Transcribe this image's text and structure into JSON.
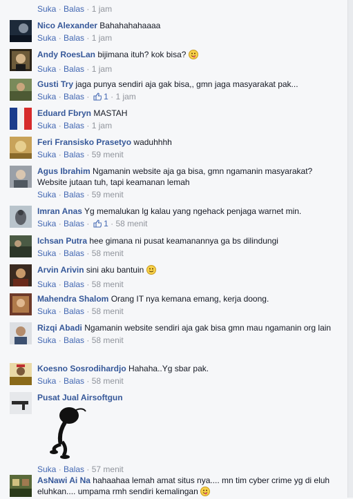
{
  "top_actions": {
    "like": "Suka",
    "reply": "Balas",
    "time": "1 jam"
  },
  "comments": [
    {
      "name": "Nico Alexander",
      "text": "Bahahahahaaaa",
      "like": "Suka",
      "reply": "Balas",
      "likes": "",
      "time": "1 jam"
    },
    {
      "name": "Andy RoesLan",
      "text": "bijimana ituh? kok bisa?",
      "like": "Suka",
      "reply": "Balas",
      "likes": "",
      "time": "1 jam"
    },
    {
      "name": "Gusti Try",
      "text": "jaga punya sendiri aja gak bisa,, gmn jaga masyarakat pak...",
      "like": "Suka",
      "reply": "Balas",
      "likes": "1",
      "time": "1 jam"
    },
    {
      "name": "Eduard Fbryn",
      "text": "MASTAH",
      "like": "Suka",
      "reply": "Balas",
      "likes": "",
      "time": "1 jam"
    },
    {
      "name": "Feri Fransisko Prasetyo",
      "text": "waduhhhh",
      "like": "Suka",
      "reply": "Balas",
      "likes": "",
      "time": "59 menit"
    },
    {
      "name": "Agus Ibrahim",
      "text": "Ngamanin website aja ga bisa, gmn ngamanin masyarakat? Website jutaan tuh, tapi keamanan lemah",
      "like": "Suka",
      "reply": "Balas",
      "likes": "",
      "time": "59 menit"
    },
    {
      "name": "Imran Anas",
      "text": "Yg memalukan lg kalau yang ngehack penjaga warnet min.",
      "like": "Suka",
      "reply": "Balas",
      "likes": "1",
      "time": "58 menit"
    },
    {
      "name": "Ichsan Putra",
      "text": "hee gimana ni pusat keamanannya ga bs dilindungi",
      "like": "Suka",
      "reply": "Balas",
      "likes": "",
      "time": "58 menit"
    },
    {
      "name": "Arvin Arivin",
      "text": "sini aku bantuin",
      "like": "Suka",
      "reply": "Balas",
      "likes": "",
      "time": "58 menit"
    },
    {
      "name": "Mahendra Shalom",
      "text": "Orang IT nya kemana emang, kerja doong.",
      "like": "Suka",
      "reply": "Balas",
      "likes": "",
      "time": "58 menit"
    },
    {
      "name": "Rizqi Abadi",
      "text": "Ngamanin website sendiri aja gak bisa gmn mau ngamanin org lain",
      "like": "Suka",
      "reply": "Balas",
      "likes": "",
      "time": "58 menit"
    },
    {
      "name": "Koesno Sosrodihardjo",
      "text": "Hahaha..Yg sbar pak.",
      "like": "Suka",
      "reply": "Balas",
      "likes": "",
      "time": "58 menit"
    },
    {
      "name": "Pusat Jual Airsoftgun",
      "text": "",
      "like": "Suka",
      "reply": "Balas",
      "likes": "",
      "time": "57 menit"
    },
    {
      "name": "AsNawi Ai Na",
      "text": "hahaahaa lemah amat situs nya.... mn tim cyber crime yg di eluh eluhkan.... umpama rmh sendiri kemalingan",
      "like": "",
      "reply": "",
      "likes": "",
      "time": ""
    }
  ]
}
